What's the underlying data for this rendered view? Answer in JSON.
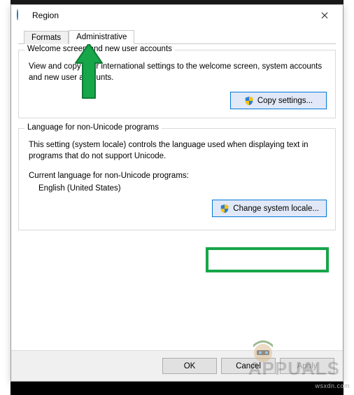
{
  "dialog": {
    "title": "Region"
  },
  "tabs": {
    "formats": "Formats",
    "administrative": "Administrative"
  },
  "group_welcome": {
    "legend": "Welcome screen and new user accounts",
    "body": "View and copy your international settings to the welcome screen, system accounts and new user accounts.",
    "copy_button": "Copy settings..."
  },
  "group_locale": {
    "legend": "Language for non-Unicode programs",
    "body": "This setting (system locale) controls the language used when displaying text in programs that do not support Unicode.",
    "current_label": "Current language for non-Unicode programs:",
    "current_value": "English (United States)",
    "change_button": "Change system locale..."
  },
  "footer": {
    "ok": "OK",
    "cancel": "Cancel",
    "apply": "Apply"
  },
  "watermark": {
    "host": "wsxdn.com",
    "brand": "APPUALS"
  }
}
